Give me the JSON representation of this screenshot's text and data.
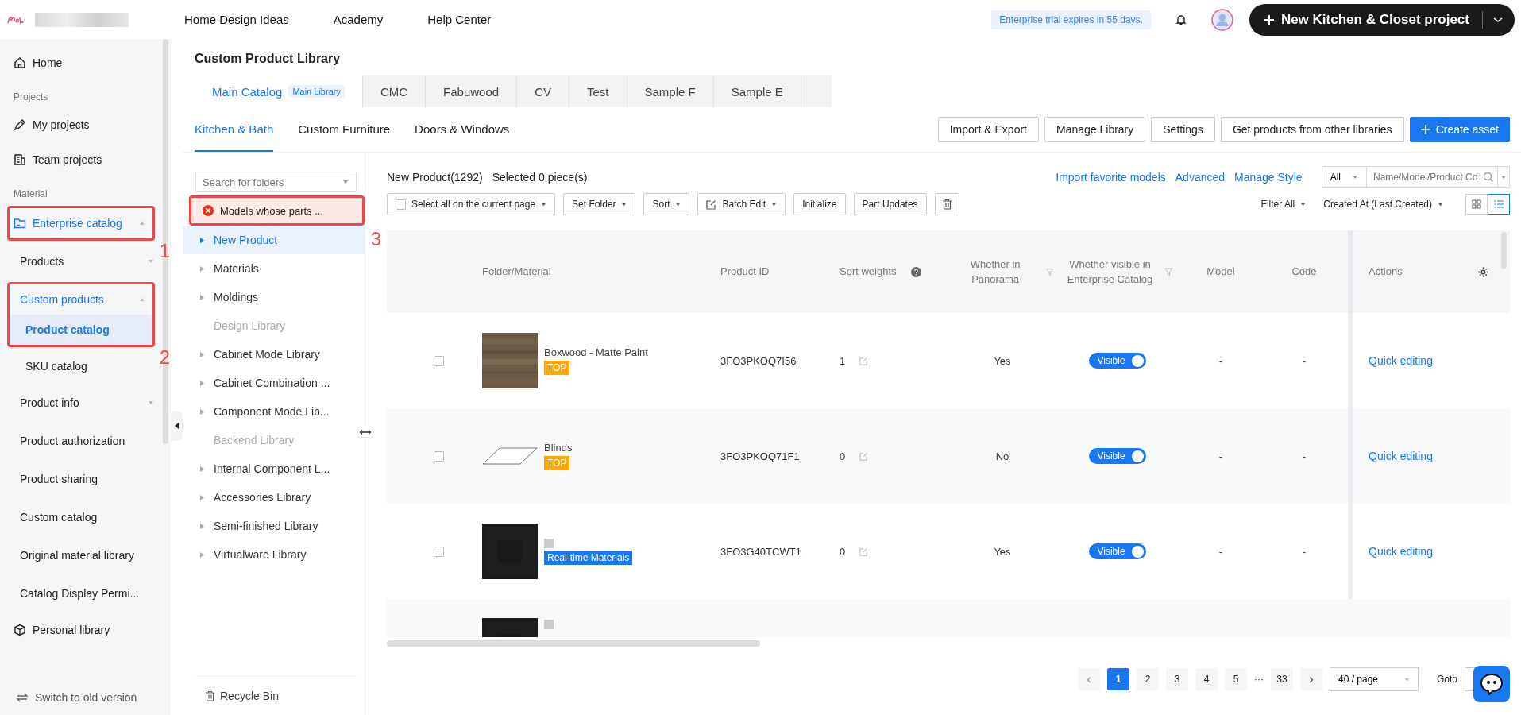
{
  "top_bar": {
    "nav": [
      "Home Design Ideas",
      "Academy",
      "Help Center"
    ],
    "trial_notice": "Enterprise trial expires in 55 days.",
    "primary_button": "New Kitchen & Closet project"
  },
  "sidebar": {
    "items": [
      {
        "kind": "link",
        "label": "Home",
        "selected": false
      },
      {
        "kind": "heading",
        "label": "Projects"
      },
      {
        "kind": "link",
        "label": "My projects",
        "selected": false
      },
      {
        "kind": "link",
        "label": "Team projects",
        "selected": false
      },
      {
        "kind": "heading",
        "label": "Material"
      },
      {
        "kind": "link",
        "label": "Enterprise catalog",
        "selected": true,
        "expanded": true,
        "annotation": "1"
      },
      {
        "kind": "group",
        "label": "Products",
        "selected": false,
        "expanded": false
      },
      {
        "kind": "group",
        "label": "Custom products",
        "selected": true,
        "expanded": true,
        "annotation": "2",
        "children": [
          {
            "label": "Product catalog",
            "selected": true
          }
        ]
      },
      {
        "kind": "sub",
        "label": "SKU catalog",
        "selected": false
      },
      {
        "kind": "group",
        "label": "Product info",
        "selected": false,
        "expanded": false
      },
      {
        "kind": "plain",
        "label": "Product authorization",
        "selected": false
      },
      {
        "kind": "plain",
        "label": "Product sharing",
        "selected": false
      },
      {
        "kind": "plain",
        "label": "Custom catalog",
        "selected": false
      },
      {
        "kind": "plain",
        "label": "Original material library",
        "selected": false
      },
      {
        "kind": "plain",
        "label": "Catalog Display Permi...",
        "selected": false
      },
      {
        "kind": "link",
        "label": "Personal library",
        "selected": false
      }
    ],
    "footer": "Switch to old version"
  },
  "page": {
    "title": "Custom Product Library",
    "tabs": [
      {
        "label": "Main Catalog",
        "badge": "Main Library",
        "selected": true
      },
      {
        "label": "CMC",
        "selected": false
      },
      {
        "label": "Fabuwood",
        "selected": false
      },
      {
        "label": "CV",
        "selected": false
      },
      {
        "label": "Test",
        "selected": false
      },
      {
        "label": "Sample F",
        "selected": false
      },
      {
        "label": "Sample E",
        "selected": false
      }
    ],
    "subtabs": [
      {
        "label": "Kitchen & Bath",
        "selected": true
      },
      {
        "label": "Custom Furniture",
        "selected": false
      },
      {
        "label": "Doors & Windows",
        "selected": false
      }
    ],
    "actions": [
      "Import & Export",
      "Manage Library",
      "Settings",
      "Get products from other libraries"
    ],
    "create_button": "Create asset"
  },
  "folders": {
    "search": {
      "placeholder": "Search for folders"
    },
    "notice": {
      "text": "Models whose parts ...",
      "annotation": "3"
    },
    "items": [
      {
        "label": "New Product",
        "kind": "folder",
        "selected": true
      },
      {
        "label": "Materials",
        "kind": "folder",
        "selected": false
      },
      {
        "label": "Moldings",
        "kind": "folder",
        "selected": false
      },
      {
        "label": "Design Library",
        "kind": "disabled",
        "selected": false
      },
      {
        "label": "Cabinet Mode Library",
        "kind": "folder",
        "selected": false
      },
      {
        "label": "Cabinet Combination ...",
        "kind": "folder",
        "selected": false
      },
      {
        "label": "Component Mode Lib...",
        "kind": "folder",
        "selected": false
      },
      {
        "label": "Backend Library",
        "kind": "disabled",
        "selected": false
      },
      {
        "label": "Internal Component L...",
        "kind": "folder",
        "selected": false
      },
      {
        "label": "Accessories Library",
        "kind": "folder",
        "selected": false
      },
      {
        "label": "Semi-finished Library",
        "kind": "folder",
        "selected": false
      },
      {
        "label": "Virtualware Library",
        "kind": "folder",
        "selected": false
      }
    ],
    "recycle_bin": "Recycle Bin"
  },
  "list": {
    "summary": "New Product(1292)",
    "selection": "Selected 0 piece(s)",
    "links": [
      "Import favorite models",
      "Advanced",
      "Manage Style"
    ],
    "scope": "All",
    "search": {
      "placeholder": "Name/Model/Product Co"
    },
    "toolbar": [
      {
        "kind": "checkbox",
        "label": "Select all on the current page",
        "checked": false
      },
      {
        "kind": "dropdown",
        "label": "Set Folder"
      },
      {
        "kind": "dropdown",
        "label": "Sort"
      },
      {
        "kind": "edit",
        "label": "Batch Edit"
      },
      {
        "kind": "plain",
        "label": "Initialize"
      },
      {
        "kind": "plain",
        "label": "Part Updates"
      },
      {
        "kind": "delete"
      }
    ],
    "filter": "Filter All",
    "sort_by": "Created At (Last Created)",
    "views": [
      {
        "kind": "grid",
        "selected": false
      },
      {
        "kind": "list",
        "selected": true
      }
    ]
  },
  "table": {
    "columns": [
      {
        "label": "Folder/Material",
        "kind": "plain"
      },
      {
        "label": "Product ID",
        "kind": "plain"
      },
      {
        "label": "Sort weights",
        "kind": "help"
      },
      {
        "label": "Whether in Panorama",
        "kind": "filter"
      },
      {
        "label": "Whether visible in Enterprise Catalog",
        "kind": "filter"
      },
      {
        "label": "Model",
        "kind": "plain"
      },
      {
        "label": "Code",
        "kind": "plain"
      },
      {
        "label": "Actions",
        "kind": "settings"
      }
    ],
    "rows": [
      {
        "checked": false,
        "name": "Boxwood - Matte Paint",
        "tag": {
          "label": "TOP",
          "color": "#ffa800"
        },
        "product_id": "3FO3PKOQ7I56",
        "sort_weight": "1",
        "in_panorama": "Yes",
        "visibility": {
          "label": "Visible",
          "on": true
        },
        "model": "-",
        "code": "-",
        "action": "Quick editing"
      },
      {
        "checked": false,
        "name": "Blinds",
        "tag": {
          "label": "TOP",
          "color": "#ffa800"
        },
        "product_id": "3FO3PKOQ71F1",
        "sort_weight": "0",
        "in_panorama": "No",
        "visibility": {
          "label": "Visible",
          "on": true
        },
        "model": "-",
        "code": "-",
        "action": "Quick editing"
      },
      {
        "checked": false,
        "name_redacted": true,
        "tag": {
          "label": "Real-time Materials",
          "color": "#1877f2"
        },
        "product_id": "3FO3G40TCWT1",
        "sort_weight": "0",
        "in_panorama": "Yes",
        "visibility": {
          "label": "Visible",
          "on": true
        },
        "model": "-",
        "code": "-",
        "action": "Quick editing"
      },
      {
        "name_redacted": true
      }
    ]
  },
  "pagination": {
    "prev": {
      "label": "‹",
      "disabled": true
    },
    "pages": [
      {
        "label": "1",
        "kind": "page",
        "selected": true
      },
      {
        "label": "2",
        "kind": "page",
        "selected": false
      },
      {
        "label": "3",
        "kind": "page",
        "selected": false
      },
      {
        "label": "4",
        "kind": "page",
        "selected": false
      },
      {
        "label": "5",
        "kind": "page",
        "selected": false
      },
      {
        "label": "···",
        "kind": "ellipsis"
      },
      {
        "label": "33",
        "kind": "page",
        "selected": false
      }
    ],
    "next": {
      "label": "›",
      "disabled": false
    },
    "page_size": "40 / page",
    "goto": "Goto"
  }
}
